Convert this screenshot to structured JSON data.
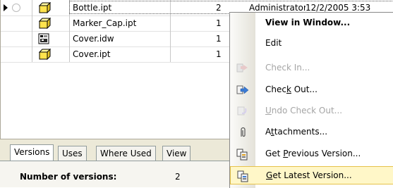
{
  "grid": {
    "rows": [
      {
        "name": "Bottle.ipt",
        "version": "2",
        "by": "Administrator",
        "date": "12/2/2005 3:53",
        "icon": "part-icon",
        "selected": true
      },
      {
        "name": "Marker_Cap.ipt",
        "version": "1",
        "icon": "part-icon"
      },
      {
        "name": "Cover.idw",
        "version": "1",
        "icon": "drawing-icon"
      },
      {
        "name": "Cover.ipt",
        "version": "1",
        "icon": "part-icon"
      }
    ]
  },
  "tabs": [
    {
      "label": "Versions",
      "active": true
    },
    {
      "label": "Uses"
    },
    {
      "label": "Where Used"
    },
    {
      "label": "View"
    }
  ],
  "versions_panel": {
    "label": "Number of versions:",
    "value": "2"
  },
  "context_menu": {
    "items": [
      {
        "label": "View in Window...",
        "bold": true
      },
      {
        "label": "Edit"
      },
      {
        "label": "Check In...",
        "disabled": true,
        "icon": "check-in-icon"
      },
      {
        "label": "Check Out...",
        "icon": "check-out-icon"
      },
      {
        "label": "Undo Check Out...",
        "disabled": true,
        "icon": "undo-check-out-icon"
      },
      {
        "label": "Attachments...",
        "icon": "paperclip-icon"
      },
      {
        "label": "Get Previous Version...",
        "icon": "get-previous-version-icon"
      },
      {
        "label": "Get Latest Version...",
        "icon": "get-latest-version-icon",
        "highlighted": true
      }
    ]
  },
  "colors": {
    "menu_highlight": "#fff7c8",
    "tab_bar": "#ece9d8",
    "part_icon_fill": "#ffe34d"
  }
}
